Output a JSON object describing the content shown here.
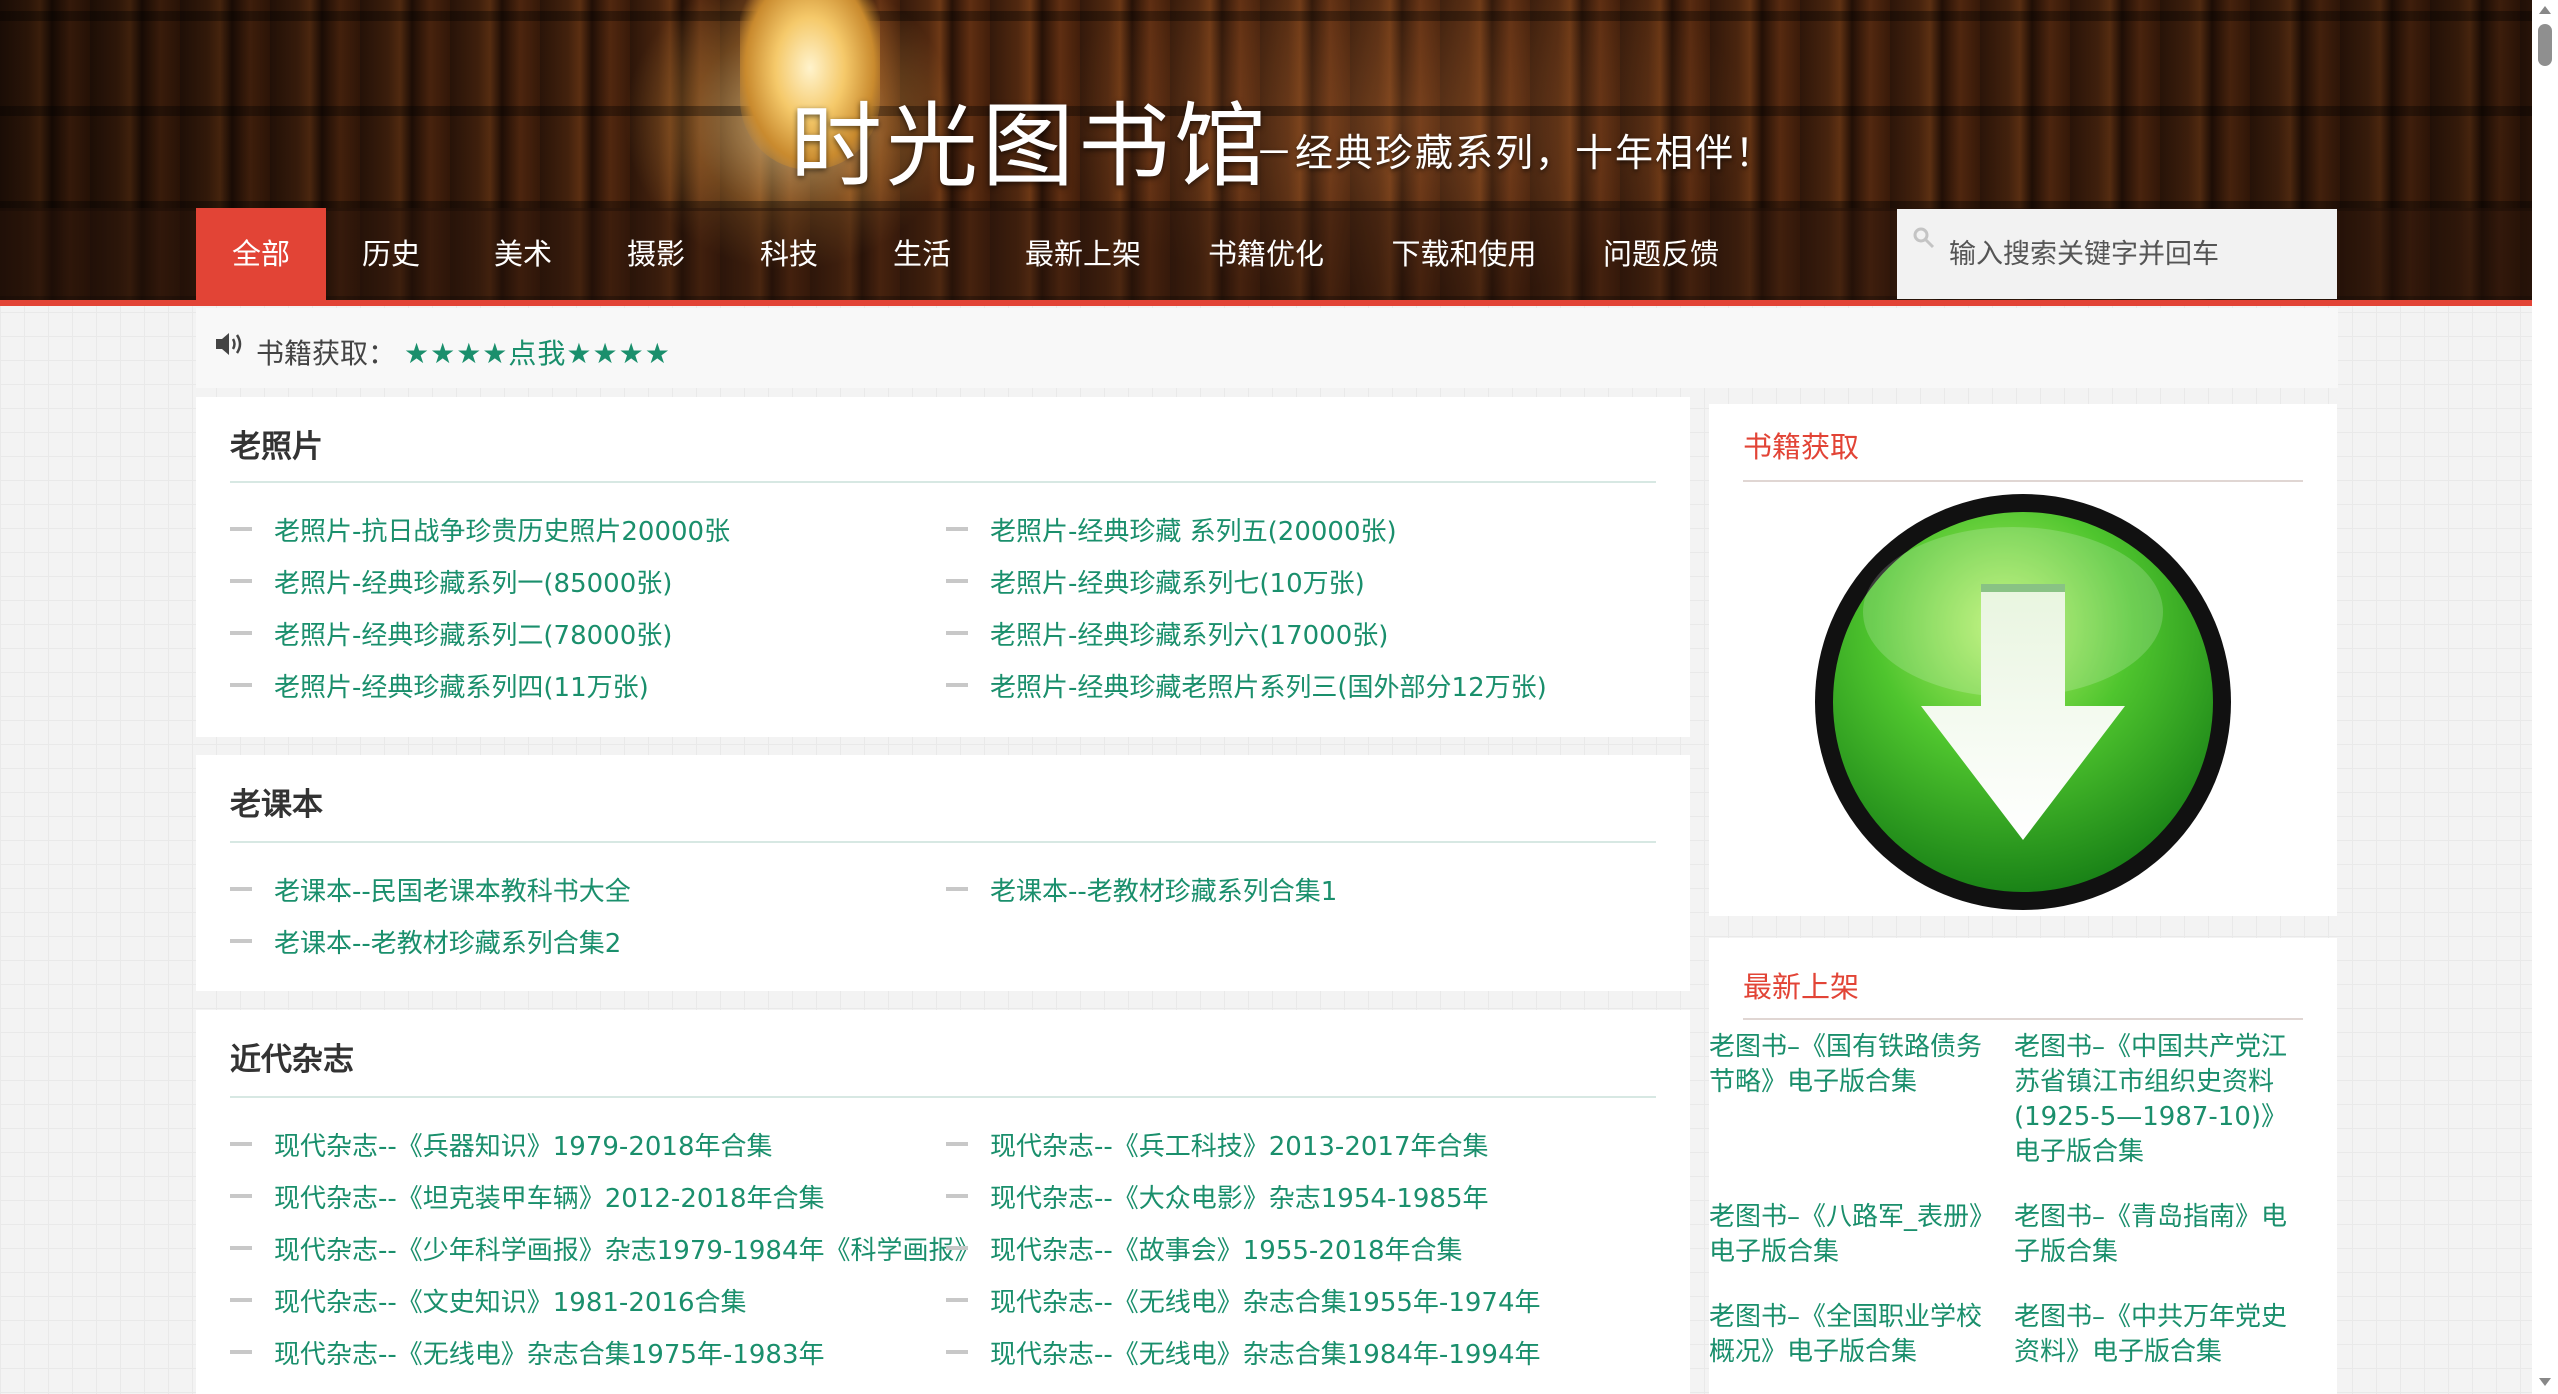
{
  "header": {
    "title": "时光图书馆",
    "tagline": "－经典珍藏系列，十年相伴！"
  },
  "nav": {
    "items": [
      "全部",
      "历史",
      "美术",
      "摄影",
      "科技",
      "生活",
      "最新上架",
      "书籍优化",
      "下载和使用",
      "问题反馈"
    ],
    "active_index": 0
  },
  "search": {
    "placeholder": "输入搜索关键字并回车",
    "value": ""
  },
  "notice": {
    "label": "书籍获取：",
    "link": "★★★★点我★★★★"
  },
  "sections": [
    {
      "title": "老照片",
      "links": [
        "老照片-抗日战争珍贵历史照片20000张",
        "老照片-经典珍藏 系列五(20000张)",
        "老照片-经典珍藏系列一(85000张)",
        "老照片-经典珍藏系列七(10万张)",
        "老照片-经典珍藏系列二(78000张)",
        "老照片-经典珍藏系列六(17000张)",
        "老照片-经典珍藏系列四(11万张)",
        "老照片-经典珍藏老照片系列三(国外部分12万张)"
      ]
    },
    {
      "title": "老课本",
      "links": [
        "老课本--民国老课本教科书大全",
        "老课本--老教材珍藏系列合集1",
        "老课本--老教材珍藏系列合集2"
      ]
    },
    {
      "title": "近代杂志",
      "links": [
        "现代杂志--《兵器知识》1979-2018年合集",
        "现代杂志--《兵工科技》2013-2017年合集",
        "现代杂志--《坦克装甲车辆》2012-2018年合集",
        "现代杂志--《大众电影》杂志1954-1985年",
        "现代杂志--《少年科学画报》杂志1979-1984年《科学画报》",
        "现代杂志--《故事会》1955-2018年合集",
        "现代杂志--《文史知识》1981-2016合集",
        "现代杂志--《无线电》杂志合集1955年-1974年",
        "现代杂志--《无线电》杂志合集1975年-1983年",
        "现代杂志--《无线电》杂志合集1984年-1994年"
      ]
    }
  ],
  "sidebar": {
    "download_widget": {
      "title": "书籍获取",
      "icon": "download-arrow-icon"
    },
    "new_books_widget": {
      "title": "最新上架",
      "items": [
        "老图书–《国有铁路债务节略》电子版合集",
        "老图书–《中国共产党江苏省镇江市组织史资料(1925-5—1987-10)》电子版合集",
        "老图书–《八路军_表册》电子版合集",
        "老图书–《青岛指南》电子版合集",
        "老图书–《全国职业学校概况》电子版合集",
        "老图书–《中共万年党史资料》电子版合集"
      ]
    }
  },
  "colors": {
    "accent_red": "#e24436",
    "link_green": "#1a8f6c",
    "download_green": "#3bb82b"
  }
}
